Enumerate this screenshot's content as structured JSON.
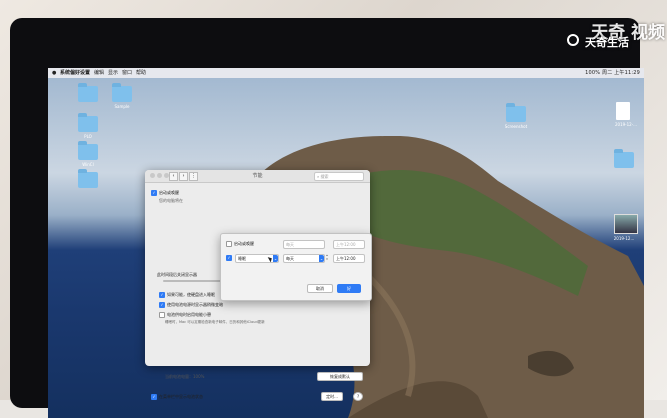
{
  "menubar": {
    "app_name": "系统偏好设置",
    "menus": [
      "编辑",
      "显示",
      "窗口",
      "帮助"
    ],
    "status": "100%  周二 上午11:29"
  },
  "desktop_icons": [
    {
      "label": ""
    },
    {
      "label": "Sample"
    },
    {
      "label": "PLO"
    },
    {
      "label": "WinCl"
    },
    {
      "label": ""
    },
    {
      "label": "Screenshot"
    },
    {
      "label": "2019-12-..."
    },
    {
      "label": ""
    },
    {
      "label": "2019-12..."
    }
  ],
  "prefwin": {
    "title": "节能",
    "search_placeholder": "搜索",
    "start_label": "启动或唤醒",
    "start_desc": "您的电脑将在",
    "slider_label": "此时间段后关闭显示器",
    "options": [
      {
        "label": "如果可能，使硬盘进入睡眠",
        "checked": true
      },
      {
        "label": "使用电池电源时显示器稍微变暗",
        "checked": true
      },
      {
        "label": "电池供电时启用电能小憩",
        "checked": false
      }
    ],
    "note": "睡眠时，Mac 可以定期检查新电子邮件、日历和其他iCloud更新",
    "battery": "当前电池电量：100%",
    "restore_button": "恢复成默认",
    "menubar_check": "在菜单栏中显示电池状态",
    "schedule_button": "定时...",
    "help": "?"
  },
  "sheet": {
    "row1": {
      "label": "启动或唤醒",
      "select": "每天",
      "time": "上午12:00",
      "checked": false
    },
    "row2": {
      "select_action": "睡眠",
      "select_day": "每天",
      "time": "上午12:00",
      "checked": true
    },
    "cancel_button": "取消",
    "ok_button": "好"
  },
  "watermark": {
    "big": "天奇 视频",
    "small": "天奇生活"
  }
}
